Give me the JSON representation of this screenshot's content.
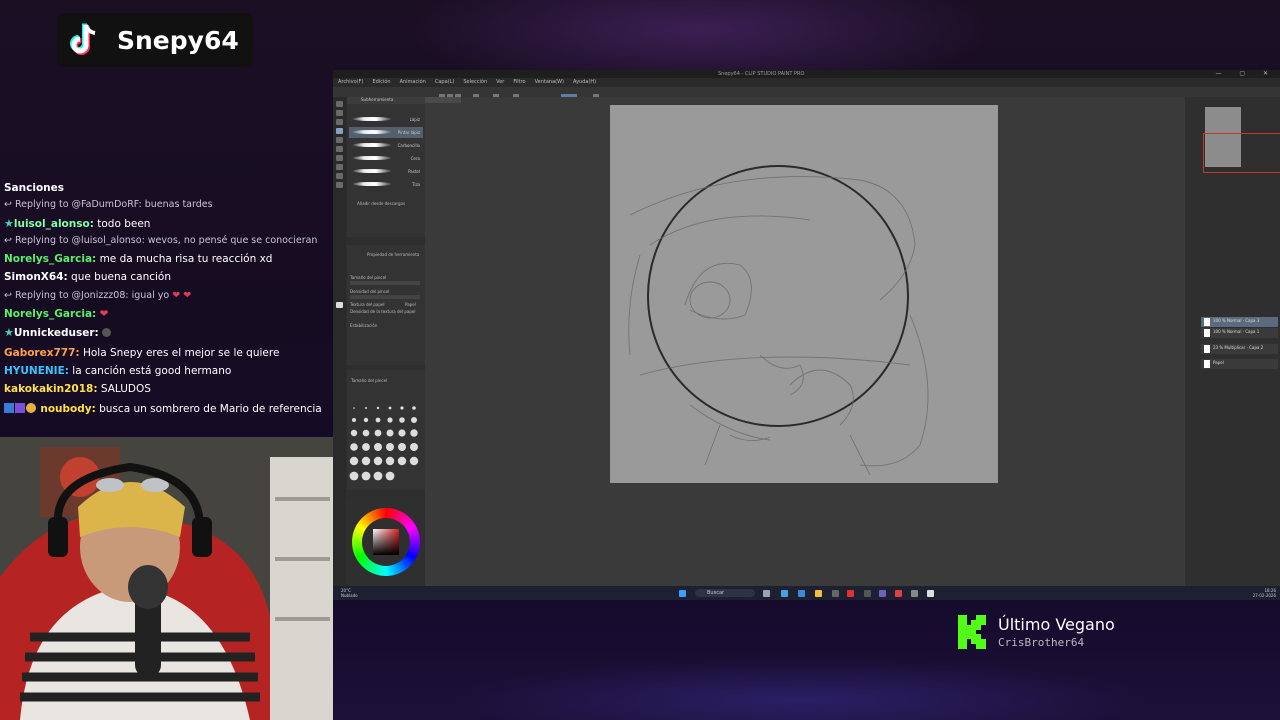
{
  "tiktok": {
    "name": "Snepy64"
  },
  "chat": {
    "lines": [
      {
        "kind": "msg",
        "user": "Sanciones",
        "text": ""
      },
      {
        "kind": "reply",
        "text": "Replying to @FaDumDoRF: buenas tardes"
      },
      {
        "kind": "msg",
        "user": "luisol_alonso:",
        "text": " todo been",
        "color": "#7fffa8"
      },
      {
        "kind": "reply",
        "text": "Replying to @luisol_alonso: wevos, no pensé que se conocieran"
      },
      {
        "kind": "msg",
        "user": "Norelys_Garcia:",
        "text": " me da mucha risa tu reacción xd",
        "color": "#5af06a"
      },
      {
        "kind": "msg",
        "user": "SimonX64:",
        "text": " que buena canción",
        "color": "#ffffff"
      },
      {
        "kind": "reply",
        "text": "Replying to @Jonizzz08: igual yo"
      },
      {
        "kind": "msg",
        "user": "Norelys_Garcia:",
        "text": "",
        "color": "#5af06a"
      },
      {
        "kind": "msg",
        "user": "Unnickeduser:",
        "text": "",
        "color": "#ffffff"
      },
      {
        "kind": "msg",
        "user": "Gaborex777:",
        "text": " Hola Snepy eres el mejor se le quiere",
        "color": "#ffa24a"
      },
      {
        "kind": "msg",
        "user": "HYUNENIE:",
        "text": " la canción está good hermano",
        "color": "#39c3ff"
      },
      {
        "kind": "msg",
        "user": "kakokakin2018:",
        "text": " SALUDOS",
        "color": "#ffe14a"
      },
      {
        "kind": "msg",
        "user": "noubody:",
        "text": " busca un sombrero de Mario de referencia",
        "color": "#ffe14a"
      }
    ]
  },
  "app": {
    "title": "Snepy64 - CLIP STUDIO PAINT PRO",
    "menu": [
      "Archivo(F)",
      "Edición",
      "Animación",
      "Capa(L)",
      "Selección",
      "Ver",
      "Filtro",
      "Ventana(W)",
      "Ayuda(H)"
    ],
    "subtool_tab": "Subherramienta",
    "brushes": [
      {
        "label": "Lápiz"
      },
      {
        "label": "Pintar lápiz"
      },
      {
        "label": "Carboncillo"
      },
      {
        "label": "Cera"
      },
      {
        "label": "Pastel"
      },
      {
        "label": "Tiza"
      }
    ],
    "add_brush": "Añadir desde descargas",
    "props": {
      "title": "Propiedad de herramienta",
      "size": "Tamaño del pincel",
      "density": "Densidad del pincel",
      "paper": "Textura del papel",
      "paper_value": "Papel",
      "texture": "Densidad de la textura del papel",
      "stab": "Estabilización"
    },
    "brush_size_title": "Tamaño del pincel",
    "layers": [
      {
        "label": "100 % Normal · Capa 3"
      },
      {
        "label": "100 % Normal · Capa 1"
      },
      {
        "label": "23 % Multiplicar · Capa 2"
      },
      {
        "label": "Papel"
      }
    ],
    "taskbar": {
      "weather_temp": "20°C",
      "weather_text": "Nublado",
      "search": "Buscar",
      "time": "18:26",
      "date": "27-02-2026"
    }
  },
  "now_playing": {
    "title": "Último Vegano",
    "artist": "CrisBrother64",
    "accent": "#53fc18"
  }
}
